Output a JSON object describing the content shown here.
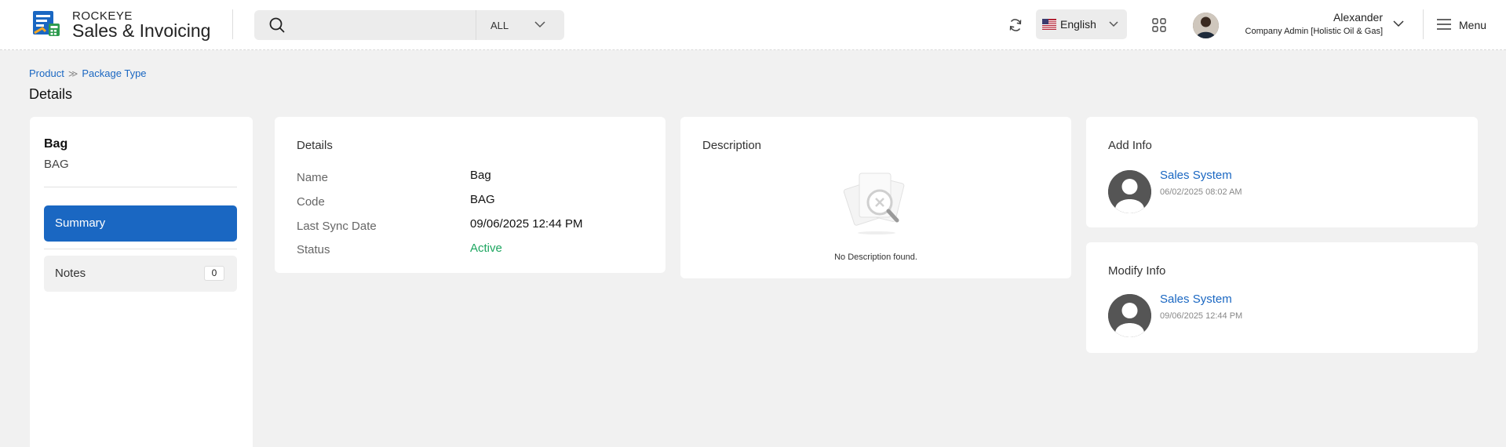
{
  "app": {
    "brand_top": "ROCKEYE",
    "brand_main": "Sales & Invoicing"
  },
  "search": {
    "placeholder": "",
    "scope": "ALL"
  },
  "language": {
    "label": "English"
  },
  "user": {
    "name": "Alexander",
    "role": "Company Admin [Holistic Oil & Gas]"
  },
  "menu": {
    "label": "Menu"
  },
  "breadcrumb": {
    "items": [
      "Product",
      "Package Type"
    ]
  },
  "page": {
    "title": "Details"
  },
  "item": {
    "name": "Bag",
    "code": "BAG"
  },
  "sidebar": {
    "summary_label": "Summary",
    "notes_label": "Notes",
    "notes_count": "0"
  },
  "details": {
    "title": "Details",
    "rows": [
      {
        "label": "Name",
        "value": "Bag"
      },
      {
        "label": "Code",
        "value": "BAG"
      },
      {
        "label": "Last Sync Date",
        "value": "09/06/2025 12:44 PM"
      },
      {
        "label": "Status",
        "value": "Active"
      }
    ]
  },
  "description": {
    "title": "Description",
    "empty_text": "No Description found."
  },
  "add_info": {
    "title": "Add Info",
    "user": "Sales System",
    "date": "06/02/2025 08:02 AM"
  },
  "modify_info": {
    "title": "Modify Info",
    "user": "Sales System",
    "date": "09/06/2025 12:44 PM"
  },
  "colors": {
    "primary": "#1a67c2",
    "active": "#1da660",
    "background": "#f1f1f1"
  }
}
